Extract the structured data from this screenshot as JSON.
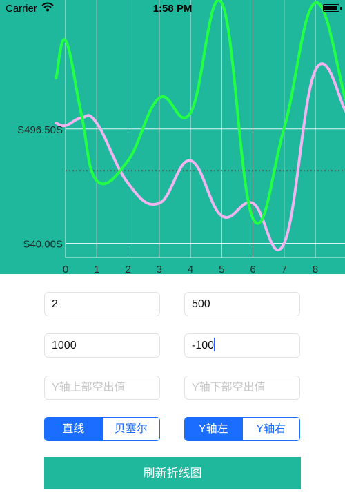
{
  "status_bar": {
    "carrier": "Carrier",
    "time": "1:58 PM",
    "wifi_icon": "wifi-icon",
    "battery_icon": "battery-icon"
  },
  "chart_data": {
    "type": "line",
    "x_ticks": [
      "0",
      "1",
      "2",
      "3",
      "4",
      "5",
      "6",
      "7",
      "8"
    ],
    "y_tick_labels": [
      "S496.50S",
      "S40.00S"
    ],
    "y_tick_values": [
      496.5,
      40.0
    ],
    "limit_line_value": 330,
    "smooth": true,
    "grid": true,
    "background": "#1fb89c",
    "series": [
      {
        "color": "#22ff44",
        "x": [
          -0.3,
          0,
          0.5,
          1,
          2,
          3,
          4,
          5,
          6,
          7,
          8,
          9,
          9.3
        ],
        "values": [
          700,
          850,
          560,
          290,
          370,
          620,
          560,
          1000,
          140,
          500,
          1000,
          600,
          520
        ]
      },
      {
        "color": "#f0b5f0",
        "x": [
          -0.3,
          0,
          0.5,
          1,
          2,
          3,
          4,
          5,
          6,
          7,
          8,
          9,
          9.3
        ],
        "values": [
          520,
          510,
          540,
          520,
          280,
          200,
          370,
          150,
          200,
          40,
          730,
          560,
          480
        ]
      }
    ]
  },
  "form": {
    "field1": {
      "value": "2"
    },
    "field2": {
      "value": "500"
    },
    "field3": {
      "value": "1000"
    },
    "field4": {
      "value": "-100"
    },
    "field5": {
      "placeholder": "Y轴上部空出值"
    },
    "field6": {
      "placeholder": "Y轴下部空出值"
    }
  },
  "segment_line": {
    "selected": 0,
    "options": [
      "直线",
      "贝塞尔"
    ]
  },
  "segment_axis": {
    "selected": 0,
    "options": [
      "Y轴左",
      "Y轴右"
    ]
  },
  "refresh_button_label": "刷新折线图",
  "colors": {
    "chart_bg": "#1fb89c",
    "accent": "#1a6dff",
    "series_green": "#22ff44",
    "series_pink": "#f0b5f0"
  }
}
